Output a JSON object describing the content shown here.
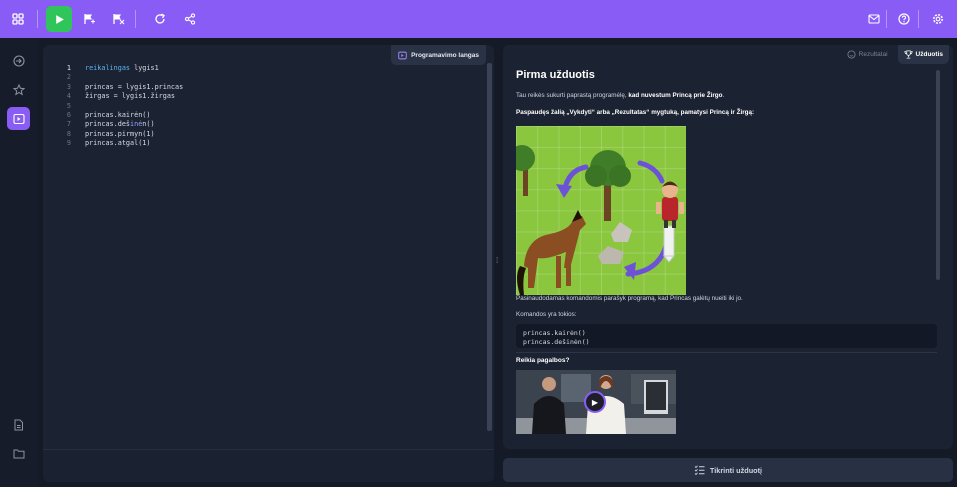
{
  "toolbar": {
    "left_icons": [
      "grid-menu-icon",
      "play-icon",
      "flag-step-icon",
      "flag-run-icon",
      "refresh-icon",
      "share-icon"
    ],
    "right_icons": [
      "mail-icon",
      "help-icon",
      "settings-icon"
    ],
    "accent_color": "#8a5cf6",
    "run_color": "#2fc55a"
  },
  "sidebar": {
    "icons": [
      "login-icon",
      "star-icon",
      "editor-icon",
      "document-icon",
      "folder-icon"
    ],
    "active": "editor-icon"
  },
  "editor": {
    "tag_label": "Programavimo langas",
    "lines": [
      {
        "n": "1",
        "parts": [
          {
            "t": "reikalingas",
            "c": "kw"
          },
          {
            "t": " lygis1"
          }
        ]
      },
      {
        "n": "2",
        "parts": []
      },
      {
        "n": "3",
        "parts": [
          {
            "t": "princas = lygis1.princas"
          }
        ]
      },
      {
        "n": "4",
        "parts": [
          {
            "t": "žirgas = lygis1.žirgas"
          }
        ]
      },
      {
        "n": "5",
        "parts": []
      },
      {
        "n": "6",
        "parts": [
          {
            "t": "princas.kairėn()"
          }
        ]
      },
      {
        "n": "7",
        "parts": [
          {
            "t": "princas.deš"
          },
          {
            "t": "inė",
            "c": "hl"
          },
          {
            "t": "n()"
          }
        ]
      },
      {
        "n": "8",
        "parts": [
          {
            "t": "princas.pirmyn(1)"
          }
        ]
      },
      {
        "n": "9",
        "parts": [
          {
            "t": "princas.atgal(1)"
          }
        ]
      }
    ]
  },
  "panel": {
    "tab_results": "Rezultatai",
    "tab_task": "Užduotis",
    "title": "Pirma užduotis",
    "intro_plain": "Tau reikės sukurti paprastą programėlę, ",
    "intro_bold": "kad nuvestum Princą prie Žirgo",
    "intro_end": ".",
    "instruction": "Paspaudęs žalią „Vykdyti“ arba „Rezultatas“ mygtuką, pamatysi Princą ir Žirgą:",
    "after_image": "Pasinaudodamas komandomis parašyk programą, kad Princas galėtų nueiti iki jo.",
    "commands_intro": "Komandos yra tokios:",
    "commands": [
      "princas.kairėn()",
      "princas.dešinėn()"
    ],
    "help_title": "Reikia pagalbos?"
  },
  "check_button": "Tikrinti užduotį"
}
